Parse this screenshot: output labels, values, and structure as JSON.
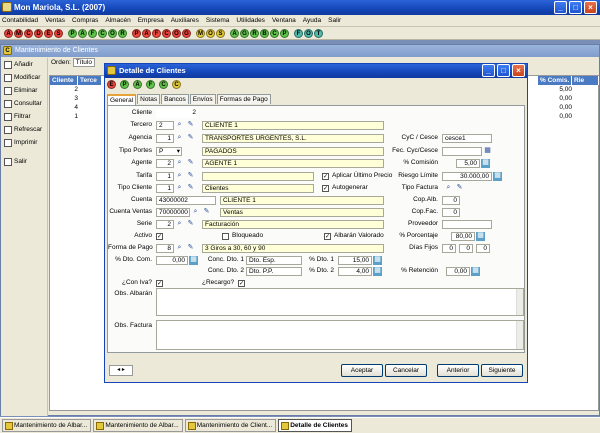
{
  "app": {
    "title": "Mon Mariola, S.L. (2007)"
  },
  "menu": [
    "Contabilidad",
    "Ventas",
    "Compras",
    "Almacén",
    "Empresa",
    "Auxiliares",
    "Sistema",
    "Utilidades",
    "Ventana",
    "Ayuda",
    "Salir"
  ],
  "toolbar_groups": [
    {
      "letters": [
        "A",
        "M",
        "C",
        "D",
        "E",
        "S"
      ],
      "color": "r"
    },
    {
      "letters": [
        "P",
        "A",
        "F",
        "C",
        "O",
        "R"
      ],
      "color": "g"
    },
    {
      "letters": [
        "P",
        "A",
        "F",
        "C",
        "O",
        "G"
      ],
      "color": "b"
    },
    {
      "letters": [
        "M",
        "O",
        "S"
      ],
      "color": "y"
    },
    {
      "letters": [
        "A",
        "G",
        "R",
        "B",
        "C",
        "P"
      ],
      "color": "g"
    },
    {
      "letters": [
        "F",
        "O",
        "T"
      ],
      "color": "t"
    }
  ],
  "child": {
    "title": "Mantenimiento de Clientes",
    "order_label": "Orden:",
    "order_value": "Título",
    "side": [
      "Añadir",
      "Modificar",
      "Eliminar",
      "Consultar",
      "Filtrar",
      "Refrescar",
      "Imprimir",
      "Salir"
    ],
    "col_cliente": "Cliente",
    "col_terc": "Terce",
    "col_comis": "% Comis.",
    "col_rie": "Rie",
    "rows": [
      {
        "c": "2",
        "comis": "5,00"
      },
      {
        "c": "3",
        "comis": "0,00"
      },
      {
        "c": "4",
        "comis": "0,00"
      },
      {
        "c": "1",
        "comis": "0,00"
      }
    ]
  },
  "dialog": {
    "title": "Detalle de Clientes",
    "tb": [
      "E",
      "P",
      "A",
      "F",
      "C",
      "C"
    ],
    "tabs": [
      "General",
      "Notas",
      "Bancos",
      "Envíos",
      "Formas de Pago"
    ],
    "labels": {
      "cliente": "Cliente",
      "tercero": "Tercero",
      "agencia": "Agencia",
      "tipo_portes": "Tipo Portes",
      "agente": "Agente",
      "tarifa": "Tarifa",
      "tipo_cliente": "Tipo Cliente",
      "cuenta": "Cuenta",
      "cuenta_ventas": "Cuenta Ventas",
      "serie": "Serie",
      "activo": "Activo",
      "forma_pago": "Forma de Pago",
      "dto_com": "% Dto. Com.",
      "con_iva": "¿Con Iva?",
      "obs_albaran": "Obs. Albarán",
      "obs_factura": "Obs. Factura",
      "cyc": "CyC / Cesce",
      "fec_cyc": "Fec. Cyc/Cesce",
      "comision": "% Comisión",
      "riesgo": "Riesgo Límite",
      "tipo_factura": "Tipo Factura",
      "cop_alb": "Cop.Alb.",
      "cop_fac": "Cop.Fac.",
      "proveedor": "Proveedor",
      "porcentaje": "% Porcentaje",
      "dias_fijos": "Días Fijos",
      "retencion": "% Retención",
      "aplicar_ultimo": "Aplicar Último Precio",
      "autogenerar": "Autogenerar",
      "bloqueado": "Bloqueado",
      "albaran_valorado": "Albarán Valorado",
      "conc1": "Conc. Dto. 1",
      "conc2": "Conc. Dto. 2",
      "dto1": "% Dto. 1",
      "dto2": "% Dto. 2",
      "recargo": "¿Recargo?"
    },
    "values": {
      "cliente": "2",
      "tercero_code": "2",
      "tercero_name": "CLIENTE 1",
      "agencia_code": "1",
      "agencia_name": "TRANSPORTES URGENTES, S.L.",
      "tipo_portes_code": "P",
      "tipo_portes_name": "PAGADOS",
      "agente_code": "2",
      "agente_name": "AGENTE 1",
      "tarifa_code": "1",
      "tipo_cliente_code": "1",
      "tipo_cliente_name": "Clientes",
      "cuenta": "43000002",
      "cuenta_name": "CLIENTE 1",
      "cuenta_ventas": "70000000",
      "cuenta_ventas_name": "Ventas",
      "serie_code": "2",
      "serie_name": "Facturación",
      "forma_pago_code": "8",
      "forma_pago_name": "3 Giros a 30, 60 y 90",
      "dto_com": "0,00",
      "conc1": "Dto. Esp.",
      "conc2": "Dto. P.P.",
      "dto1": "15,00",
      "dto2": "4,00",
      "cyc": "cesce1",
      "comision": "5,00",
      "riesgo": "30.000,00",
      "cop_alb": "0",
      "cop_fac": "0",
      "porcentaje": "80,00",
      "dias1": "0",
      "dias2": "0",
      "dias3": "0",
      "retencion": "0,00"
    },
    "buttons": [
      "Aceptar",
      "Cancelar",
      "Anterior",
      "Siguiente"
    ]
  },
  "taskbar": [
    "Mantenimiento de Albar...",
    "Mantenimiento de Albar...",
    "Mantenimiento de Client...",
    "Detalle de Clientes"
  ]
}
